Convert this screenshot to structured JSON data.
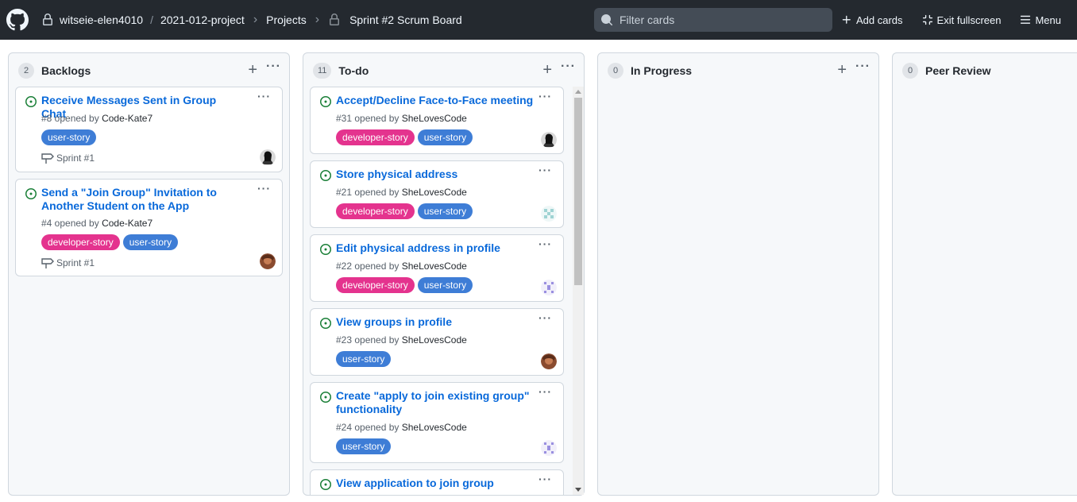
{
  "topbar": {
    "breadcrumb": {
      "owner": "witseie-elen4010",
      "separator": "/",
      "repo": "2021-012-project",
      "projects": "Projects",
      "board": "Sprint #2 Scrum Board"
    },
    "search_placeholder": "Filter cards",
    "actions": {
      "add_cards": "Add cards",
      "exit_fullscreen": "Exit fullscreen",
      "menu": "Menu"
    }
  },
  "columns": [
    {
      "title": "Backlogs",
      "count": "2",
      "cards": [
        {
          "title": "Receive Messages Sent in Group Chat",
          "meta_prefix": "#8 opened by",
          "author": "Code-Kate7",
          "labels": [
            "user-story"
          ],
          "milestone": "Sprint #1"
        },
        {
          "title": "Send a \"Join Group\" Invitation to Another Student on the App",
          "meta_prefix": "#4 opened by",
          "author": "Code-Kate7",
          "labels": [
            "developer-story",
            "user-story"
          ],
          "milestone": "Sprint #1"
        }
      ]
    },
    {
      "title": "To-do",
      "count": "11",
      "cards": [
        {
          "title": "Accept/Decline Face-to-Face meeting",
          "meta_prefix": "#31 opened by",
          "author": "SheLovesCode",
          "labels": [
            "developer-story",
            "user-story"
          ]
        },
        {
          "title": "Store physical address",
          "meta_prefix": "#21 opened by",
          "author": "SheLovesCode",
          "labels": [
            "developer-story",
            "user-story"
          ]
        },
        {
          "title": "Edit physical address in profile",
          "meta_prefix": "#22 opened by",
          "author": "SheLovesCode",
          "labels": [
            "developer-story",
            "user-story"
          ]
        },
        {
          "title": "View groups in profile",
          "meta_prefix": "#23 opened by",
          "author": "SheLovesCode",
          "labels": [
            "user-story"
          ]
        },
        {
          "title": "Create \"apply to join existing group\" functionality",
          "meta_prefix": "#24 opened by",
          "author": "SheLovesCode",
          "labels": [
            "user-story"
          ]
        },
        {
          "title": "View application to join group"
        }
      ]
    },
    {
      "title": "In Progress",
      "count": "0"
    },
    {
      "title": "Peer Review",
      "count": "0"
    }
  ],
  "colors": {
    "topbar_bg": "#24292f",
    "link_blue": "#0969da",
    "open_green": "#1a7f37",
    "label_developer_story": "#e4338e",
    "label_user_story": "#3e7dd6"
  }
}
